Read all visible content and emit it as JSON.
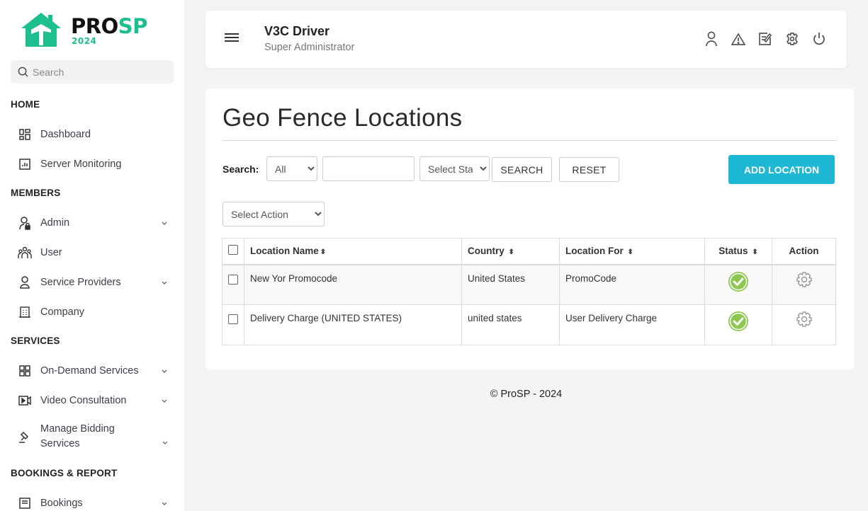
{
  "brand": {
    "name_part1": "PRO",
    "name_part2": "SP",
    "year": "2024",
    "accent_color": "#1dbf8f"
  },
  "sidebar": {
    "search_placeholder": "Search",
    "sections": [
      {
        "title": "HOME",
        "items": [
          {
            "label": "Dashboard",
            "icon": "grid-icon",
            "has_chevron": false
          },
          {
            "label": "Server Monitoring",
            "icon": "chart-icon",
            "has_chevron": false
          }
        ]
      },
      {
        "title": "MEMBERS",
        "items": [
          {
            "label": "Admin",
            "icon": "user-lock-icon",
            "has_chevron": true
          },
          {
            "label": "User",
            "icon": "users-icon",
            "has_chevron": false
          },
          {
            "label": "Service Providers",
            "icon": "provider-icon",
            "has_chevron": true
          },
          {
            "label": "Company",
            "icon": "building-icon",
            "has_chevron": false
          }
        ]
      },
      {
        "title": "SERVICES",
        "items": [
          {
            "label": "On-Demand Services",
            "icon": "grid-icon",
            "has_chevron": true
          },
          {
            "label": "Video Consultation",
            "icon": "video-icon",
            "has_chevron": true
          },
          {
            "label": "Manage Bidding Services",
            "icon": "gavel-icon",
            "has_chevron": true
          }
        ]
      },
      {
        "title": "BOOKINGS & REPORT",
        "items": [
          {
            "label": "Bookings",
            "icon": "list-icon",
            "has_chevron": true
          }
        ]
      }
    ]
  },
  "header": {
    "user_name": "V3C Driver",
    "user_role": "Super Administrator",
    "icons": [
      "user-icon",
      "alert-icon",
      "edit-icon",
      "settings-icon",
      "power-icon"
    ]
  },
  "page": {
    "title": "Geo Fence Locations",
    "search_label": "Search:",
    "search_field_select": "All",
    "search_text_value": "",
    "status_select": "Select Sta",
    "search_button": "SEARCH",
    "reset_button": "RESET",
    "add_button": "ADD LOCATION",
    "add_button_color": "#1fb8d4",
    "action_select": "Select Action"
  },
  "table": {
    "columns": [
      "Location Name",
      "Country",
      "Location For",
      "Status",
      "Action"
    ],
    "rows": [
      {
        "location_name": "New Yor Promocode",
        "country": "United States",
        "location_for": "PromoCode",
        "status": "active"
      },
      {
        "location_name": "Delivery Charge (UNITED STATES)",
        "country": "united states",
        "location_for": "User Delivery Charge",
        "status": "active"
      }
    ],
    "status_color": "#8cc751"
  },
  "footer": {
    "text": "© ProSP - 2024"
  }
}
